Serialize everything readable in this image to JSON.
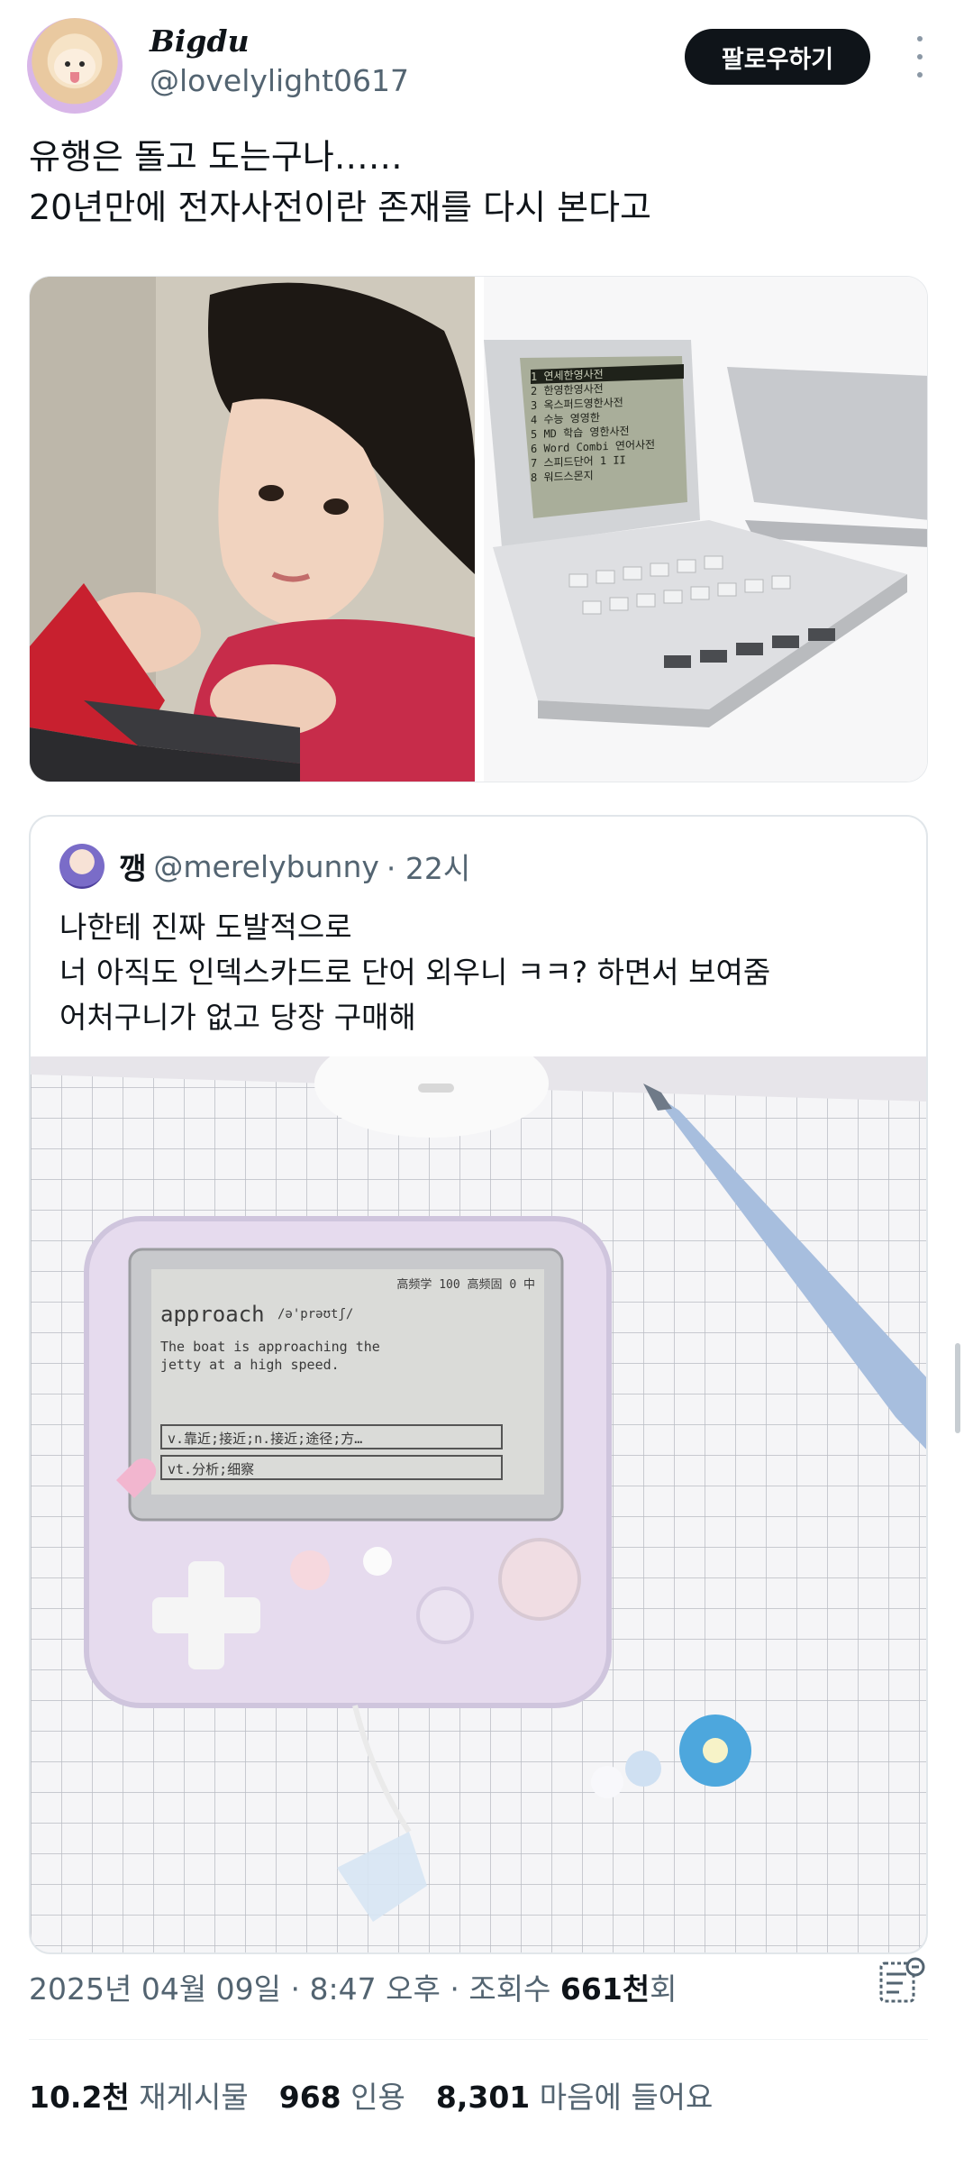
{
  "author": {
    "display_name": "Bigdu",
    "handle": "@lovelylight0617",
    "follow_label": "팔로우하기"
  },
  "tweet": {
    "lines": [
      "유행은 돌고 도는구나……",
      "20년만에 전자사전이란 존재를 다시 본다고"
    ]
  },
  "quoted": {
    "name": "깽",
    "handle": "@merelybunny",
    "time": "· 22시",
    "lines": [
      "나한테 진짜 도발적으로",
      "너 아직도 인덱스카드로 단어 외우니 ㅋㅋ? 하면서 보여줌",
      "어처구니가 없고 당장 구매해"
    ],
    "device_screen": {
      "top_line": "高频学 100 高频固  0  中",
      "word": "approach",
      "phonetic": "/ə'prəʊtʃ/",
      "example": [
        "The boat is approaching the",
        "jetty at a high speed."
      ],
      "sense1": "v.靠近;接近;n.接近;途径;方…",
      "sense2": "vt.分析;细察"
    }
  },
  "old_dictionary_screen": {
    "menu": [
      "1 연세한영사전",
      "2 한영한영사전",
      "3 옥스퍼드영한사전",
      "4 수능 영영한",
      "5 MD 학습 영한사전",
      "6 Word Combi 연어사전",
      "7 스피드단어 1 II",
      "8 워드스몬지"
    ]
  },
  "meta": {
    "date": "2025년 04월 09일",
    "time": "8:47 오후",
    "views_label": "조회수",
    "views_value": "661천",
    "views_suffix": "회"
  },
  "stats": {
    "retweets_value": "10.2천",
    "retweets_label": "재게시물",
    "quotes_value": "968",
    "quotes_label": "인용",
    "likes_value": "8,301",
    "likes_label": "마음에 들어요"
  },
  "colors": {
    "text_primary": "#0f1419",
    "text_secondary": "#536471",
    "button_bg": "#0f1419"
  }
}
